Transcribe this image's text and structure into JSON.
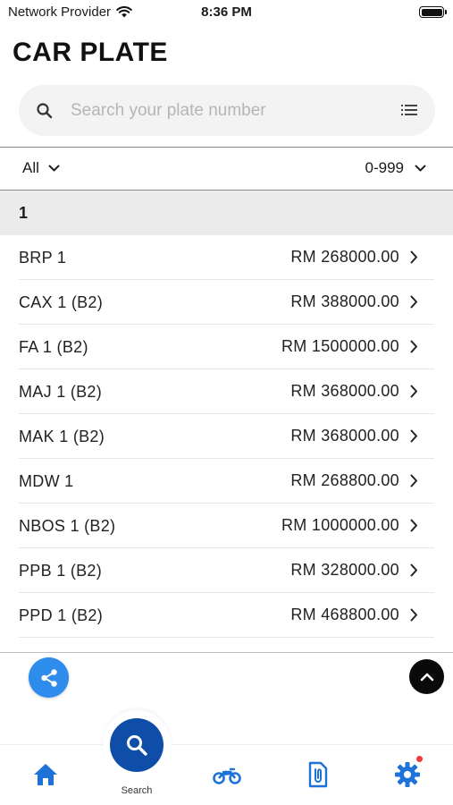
{
  "status_bar": {
    "carrier": "Network Provider",
    "time": "8:36 PM"
  },
  "header": {
    "title": "CAR PLATE"
  },
  "search": {
    "placeholder": "Search your plate number",
    "value": ""
  },
  "filters": {
    "category_selected": "All",
    "range_selected": "0-999"
  },
  "section": {
    "label": "1"
  },
  "plates": [
    {
      "name": "BRP 1",
      "price": "RM 268000.00"
    },
    {
      "name": "CAX 1 (B2)",
      "price": "RM 388000.00"
    },
    {
      "name": "FA 1 (B2)",
      "price": "RM 1500000.00"
    },
    {
      "name": "MAJ 1 (B2)",
      "price": "RM 368000.00"
    },
    {
      "name": "MAK 1 (B2)",
      "price": "RM 368000.00"
    },
    {
      "name": "MDW 1",
      "price": "RM 268800.00"
    },
    {
      "name": "NBOS 1 (B2)",
      "price": "RM 1000000.00"
    },
    {
      "name": "PPB 1 (B2)",
      "price": "RM 328000.00"
    },
    {
      "name": "PPD 1 (B2)",
      "price": "RM 468800.00"
    }
  ],
  "bottom_nav": {
    "center_label": "Search",
    "items": [
      {
        "icon": "home-icon"
      },
      {
        "icon": "search-icon"
      },
      {
        "icon": "motorcycle-icon"
      },
      {
        "icon": "attachment-icon"
      },
      {
        "icon": "gear-icon",
        "has_notification": true
      }
    ]
  },
  "colors": {
    "accent": "#0f4ea8",
    "nav_icon": "#1e73d8",
    "share_fab": "#2d8cec",
    "notification": "#ee3b3b"
  }
}
